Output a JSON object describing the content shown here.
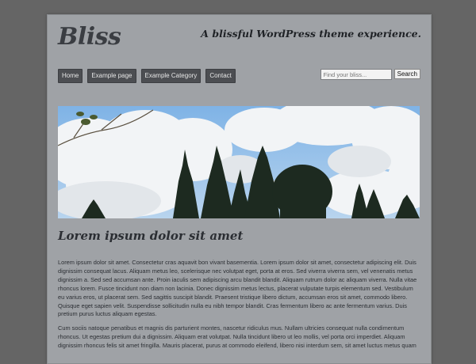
{
  "site": {
    "title": "Bliss",
    "tagline": "A blissful WordPress theme experience."
  },
  "nav": {
    "items": [
      "Home",
      "Example page",
      "Example Category",
      "Contact"
    ]
  },
  "search": {
    "placeholder": "Find your bliss...",
    "button_label": "Search"
  },
  "hero": {
    "icon": "sky-trees-photo"
  },
  "post": {
    "title": "Lorem ipsum dolor sit amet",
    "paragraphs": [
      "Lorem ipsum dolor sit amet. Consectetur cras aquavit bon vivant basementia.  Lorem ipsum dolor sit amet, consectetur adipiscing elit. Duis dignissim consequat lacus. Aliquam metus leo, scelerisque nec volutpat eget, porta at eros. Sed viverra viverra sem, vel venenatis metus dignissim a. Sed sed accumsan ante. Proin iaculis sem adipiscing arcu blandit blandit. Aliquam rutrum dolor ac aliquam viverra. Nulla vitae rhoncus lorem. Fusce tincidunt non diam non lacinia. Donec dignissim metus lectus, placerat vulputate turpis elementum sed. Vestibulum eu varius eros, ut placerat sem. Sed sagittis suscipit blandit. Praesent tristique libero dictum, accumsan eros sit amet, commodo libero. Quisque eget sapien velit. Suspendisse sollicitudin nulla eu nibh tempor blandit. Cras fermentum libero ac ante fermentum varius. Duis pretium purus luctus aliquam egestas.",
      "Cum sociis natoque penatibus et magnis dis parturient montes, nascetur ridiculus mus. Nullam ultricies consequat nulla condimentum rhoncus. Ut egestas pretium dui a dignissim. Aliquam erat volutpat. Nulla tincidunt libero ut leo mollis, vel porta orci imperdiet. Aliquam dignissim rhoncus felis sit amet fringilla. Mauris placerat, purus at commodo eleifend, libero nisi interdum sem, sit amet luctus metus quam"
    ]
  },
  "colors": {
    "outer_bg": "#656565",
    "page_bg": "#9fa2a6",
    "nav_button_bg": "#4c4e52",
    "text": "#2b2e33"
  }
}
